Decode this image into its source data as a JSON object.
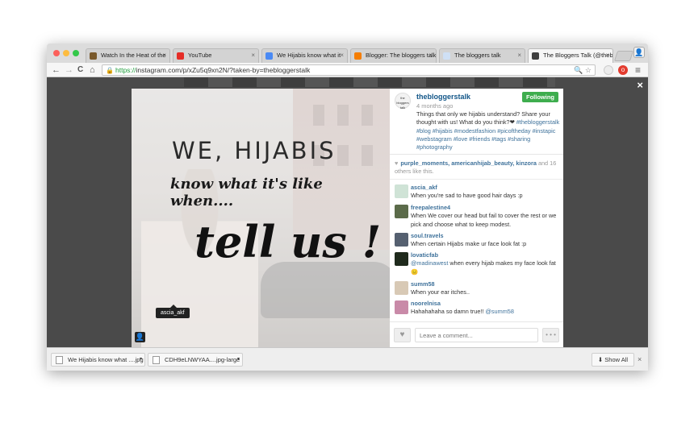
{
  "browser": {
    "tabs": [
      {
        "title": "Watch In the Heat of the",
        "fav_color": "#7a5a2c",
        "active": false
      },
      {
        "title": "YouTube",
        "fav_color": "#e52d27",
        "active": false
      },
      {
        "title": "We Hijabis know what it",
        "fav_color": "#4a8af4",
        "active": false
      },
      {
        "title": "Blogger: The bloggers talk",
        "fav_color": "#f57d00",
        "active": false
      },
      {
        "title": "The bloggers talk",
        "fav_color": "#cfe0f5",
        "active": false
      },
      {
        "title": "The Bloggers Talk (@thebl",
        "fav_color": "#3f3f3f",
        "active": true
      }
    ],
    "close_glyph": "×",
    "url_scheme": "https://",
    "url_rest": "instagram.com/p/xZu5q9xn2N/?taken-by=thebloggerstalk",
    "back_glyph": "←",
    "forward_glyph": "→",
    "reload_glyph": "C",
    "home_glyph": "⌂",
    "lock_glyph": "🔒",
    "omnibox_icons": "🔍 ☆",
    "menu_glyph": "≡",
    "profile_glyph": "👤"
  },
  "modal": {
    "close_glyph": "×",
    "image": {
      "line1": "WE, HIJABIS",
      "line2": "know what it's like when....",
      "line3": "tell us !",
      "tag_label": "ascia_akf",
      "user_icon_glyph": "👤"
    },
    "post": {
      "logo_text": "the bloggers talk",
      "username": "thebloggerstalk",
      "time_ago": "4 months ago",
      "follow_label": "Following",
      "caption_text": "Things that only we hijabis understand? Share your thought with us! What do you think?❤",
      "caption_tags": "#thebloggerstalk #blog #hijabis #modestfashion #picoftheday #instapic #webstagram #love #friends #tags #sharing #photography",
      "likes_heart": "♥",
      "likes_names": "purple_moments, americanhijab_beauty, kinzora",
      "likes_rest": "and 16 others like this."
    },
    "comments": [
      {
        "user": "ascia_akf",
        "text": "When you're sad to have good hair days :p",
        "mention": "",
        "avatar_color": "#cfe3d6"
      },
      {
        "user": "freepalestine4",
        "text": "When We cover our head but fail to cover the rest or we pick and choose what to keep modest.",
        "mention": "",
        "avatar_color": "#5b6b4a"
      },
      {
        "user": "soul.travels",
        "text": "When certain Hijabs make ur face look fat :p",
        "mention": "",
        "avatar_color": "#556070"
      },
      {
        "user": "lovaticfab",
        "text": "when every hijab makes my face look fat 😑",
        "mention": "@madinawest",
        "avatar_color": "#1f2a1c"
      },
      {
        "user": "summ58",
        "text": "When your ear itches..",
        "mention": "",
        "avatar_color": "#d8c9b5"
      },
      {
        "user": "noorelnisa",
        "text": "Hahahahaha so damn true!! ",
        "mention": "@summ58",
        "avatar_color": "#c98aa8"
      }
    ],
    "footer": {
      "like_glyph": "♥",
      "comment_placeholder": "Leave a comment...",
      "more_glyph": "• • •"
    }
  },
  "downloads": {
    "items": [
      {
        "name": "We Hijabis know what ....jpg",
        "caret": "▾"
      },
      {
        "name": "CDH9eLNWYAA....jpg-large",
        "caret": "▾"
      }
    ],
    "show_all_label": "⬇ Show All",
    "close_glyph": "×"
  },
  "colors": {
    "link_blue": "#125688",
    "tag_blue": "#3f729b",
    "follow_green": "#3ead4e",
    "overlay": "#4a4a4a"
  }
}
